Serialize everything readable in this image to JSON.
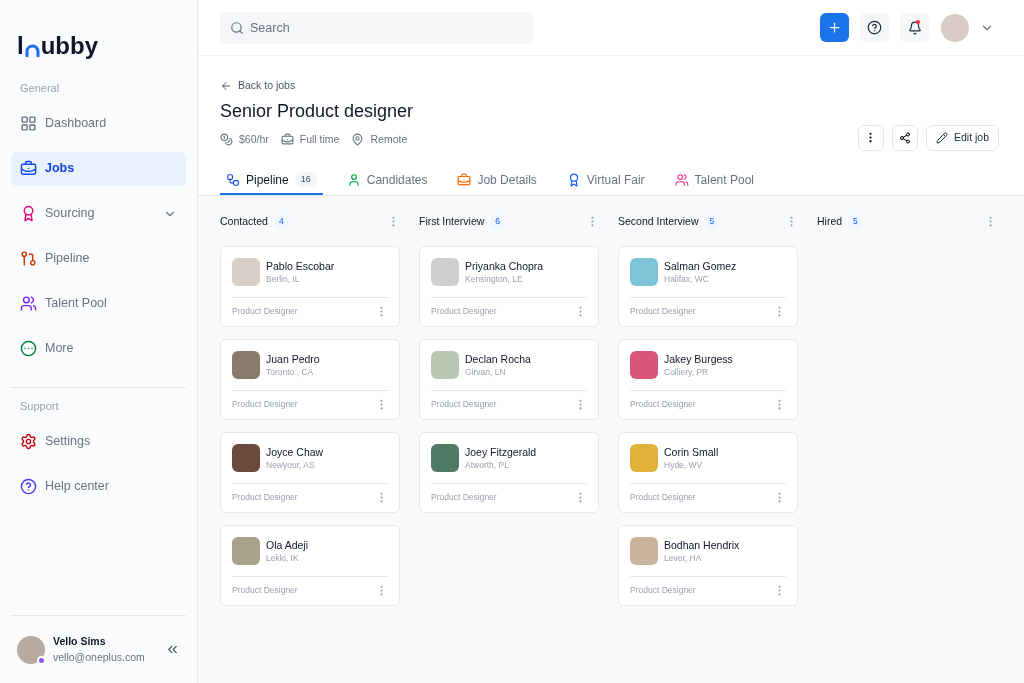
{
  "logo": {
    "start": "l",
    "end": "ubby"
  },
  "sidebar": {
    "sections": [
      {
        "heading": "General",
        "items": [
          {
            "kind": "dashboard",
            "label": "Dashboard",
            "selected": false
          },
          {
            "kind": "jobs",
            "label": "Jobs",
            "selected": true
          },
          {
            "kind": "sourcing",
            "label": "Sourcing",
            "selected": false,
            "expandable": true
          },
          {
            "kind": "pipeline",
            "label": "Pipeline",
            "selected": false
          },
          {
            "kind": "talent",
            "label": "Talent Pool",
            "selected": false
          },
          {
            "kind": "more",
            "label": "More",
            "selected": false
          }
        ]
      },
      {
        "heading": "Support",
        "items": [
          {
            "kind": "settings",
            "label": "Settings",
            "selected": false
          },
          {
            "kind": "help",
            "label": "Help center",
            "selected": false
          }
        ]
      }
    ],
    "user": {
      "name": "Vello Sims",
      "email": "vello@oneplus.com"
    }
  },
  "search": {
    "placeholder": "Search"
  },
  "header": {
    "back": "Back to jobs",
    "title": "Senior Product designer",
    "meta": [
      {
        "kind": "rate",
        "text": "$60/hr"
      },
      {
        "kind": "type",
        "text": "Full time"
      },
      {
        "kind": "location",
        "text": "Remote"
      }
    ],
    "edit": "Edit job"
  },
  "tabs": [
    {
      "kind": "pipeline",
      "label": "Pipeline",
      "count": "16",
      "selected": true
    },
    {
      "kind": "candidates",
      "label": "Candidates",
      "selected": false
    },
    {
      "kind": "details",
      "label": "Job Details",
      "selected": false
    },
    {
      "kind": "fair",
      "label": "Virtual Fair",
      "selected": false
    },
    {
      "kind": "talent",
      "label": "Talent Pool",
      "selected": false
    }
  ],
  "columns": [
    {
      "title": "Contacted",
      "count": "4",
      "cards": [
        {
          "name": "Pablo Escobar",
          "location": "Berlin, IL",
          "role": "Product Designer"
        },
        {
          "name": "Juan Pedro",
          "location": "Toronto , CA",
          "role": "Product Designer"
        },
        {
          "name": "Joyce Chaw",
          "location": "Newyour, AS",
          "role": "Product Designer"
        },
        {
          "name": "Ola Adeji",
          "location": "Lekki, IK",
          "role": "Product Designer"
        }
      ]
    },
    {
      "title": "First Interview",
      "count": "6",
      "cards": [
        {
          "name": "Priyanka Chopra",
          "location": "Kensington, LE",
          "role": "Product Designer"
        },
        {
          "name": "Declan Rocha",
          "location": "Girvan, LN",
          "role": "Product Designer"
        },
        {
          "name": "Joey Fitzgerald",
          "location": "Atworth, PL",
          "role": "Product Designer"
        }
      ]
    },
    {
      "title": "Second Interview",
      "count": "5",
      "cards": [
        {
          "name": "Salman Gomez",
          "location": "Halifax, WC",
          "role": "Product Designer"
        },
        {
          "name": "Jakey Burgess",
          "location": "Colliery, PR",
          "role": "Product Designer"
        },
        {
          "name": "Corin Small",
          "location": "Hyde, WV",
          "role": "Product Designer"
        },
        {
          "name": "Bodhan Hendrix",
          "location": "Lever, HA",
          "role": "Product Designer"
        }
      ]
    },
    {
      "title": "Hired",
      "count": "5"
    }
  ]
}
